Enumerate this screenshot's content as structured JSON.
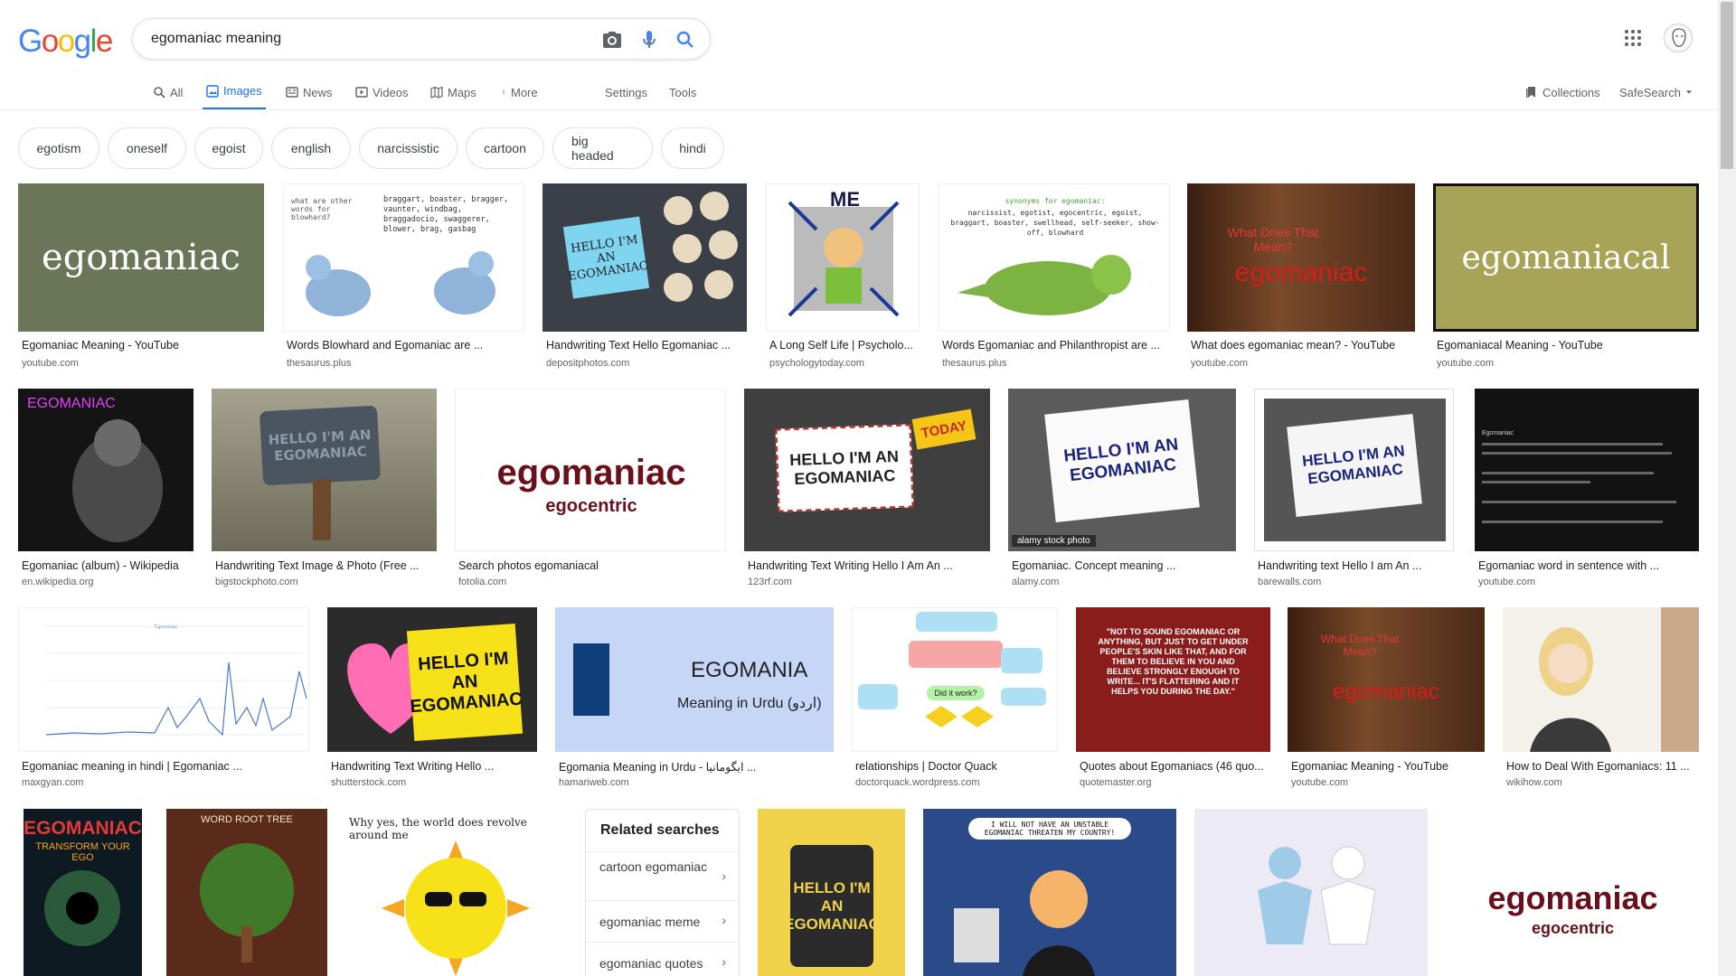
{
  "logo": {
    "letters": [
      "G",
      "o",
      "o",
      "g",
      "l",
      "e"
    ],
    "colors": [
      "#4285f4",
      "#ea4335",
      "#fbbc05",
      "#4285f4",
      "#34a853",
      "#ea4335"
    ]
  },
  "search": {
    "query": "egomaniac meaning",
    "icons": [
      "camera-icon",
      "mic-icon",
      "search-icon"
    ]
  },
  "tabs": [
    {
      "label": "All",
      "icon": "search-icon"
    },
    {
      "label": "Images",
      "icon": "image-icon",
      "active": true
    },
    {
      "label": "News",
      "icon": "news-icon"
    },
    {
      "label": "Videos",
      "icon": "video-icon"
    },
    {
      "label": "Maps",
      "icon": "map-icon"
    },
    {
      "label": "More",
      "icon": "more-vert-icon"
    },
    {
      "label": "Settings"
    },
    {
      "label": "Tools"
    },
    {
      "label": "Collections",
      "icon": "collections-icon"
    },
    {
      "label": "SafeSearch",
      "icon": "dropdown-icon"
    }
  ],
  "chips": [
    "egotism",
    "oneself",
    "egoist",
    "english",
    "narcissistic",
    "cartoon",
    "big headed",
    "hindi"
  ],
  "results": [
    {
      "title": "Egomaniac Meaning - YouTube",
      "domain": "youtube.com",
      "thumb_text": "egomaniac",
      "bg": "#6b7658"
    },
    {
      "title": "Words Blowhard and Egomaniac are ...",
      "domain": "thesaurus.plus",
      "thumb_text": "braggart, boaster, bragger, vaunter, windbag, braggadocio, swaggerer, blower, brag, gasbag",
      "sub_text": "what are other words for blowhard?",
      "bg": "#ffffff"
    },
    {
      "title": "Handwriting Text Hello Egomaniac ...",
      "domain": "depositphotos.com",
      "thumb_text": "HELLO I'M AN EGOMANIAC",
      "bg": "#3a3f48"
    },
    {
      "title": "A Long Self Life | Psycholo...",
      "domain": "psychologytoday.com",
      "thumb_text": "ME",
      "bg": "#ffffff"
    },
    {
      "title": "Words Egomaniac and Philanthropist are ...",
      "domain": "thesaurus.plus",
      "thumb_text": "synonyms for egomaniac:",
      "sub_text": "narcissist, egotist, egocentric, egoist, braggart, boaster, swellhead, self-seeker, show-off, blowhard",
      "bg": "#ffffff"
    },
    {
      "title": "What does egomaniac mean? - YouTube",
      "domain": "youtube.com",
      "thumb_text": "egomaniac",
      "sub_text": "What Does That Mean?",
      "bg": "#5a2f1c"
    },
    {
      "title": "Egomaniacal Meaning - YouTube",
      "domain": "youtube.com",
      "thumb_text": "egomaniacal",
      "bg": "#a7a457"
    },
    {
      "title": "Egomaniac (album) - Wikipedia",
      "domain": "en.wikipedia.org",
      "thumb_text": "EGOMANIAC",
      "bg": "#141414"
    },
    {
      "title": "Handwriting Text Image & Photo (Free ...",
      "domain": "bigstockphoto.com",
      "thumb_text": "HELLO I'M AN EGOMANIAC",
      "bg": "#8c8a77"
    },
    {
      "title": "Search photos egomaniacal",
      "domain": "fotolia.com",
      "thumb_text": "egomaniac",
      "sub_text": "egocentric",
      "bg": "#ffffff"
    },
    {
      "title": "Handwriting Text Writing Hello I Am An ...",
      "domain": "123rf.com",
      "thumb_text": "HELLO I'M AN EGOMANIAC",
      "sub_text": "TODAY",
      "bg": "#3f3f3f"
    },
    {
      "title": "Egomaniac. Concept meaning ...",
      "domain": "alamy.com",
      "thumb_text": "HELLO I'M AN EGOMANIAC",
      "sub_text": "alamy stock photo",
      "bg": "#5b5b5b"
    },
    {
      "title": "Handwriting text Hello I am An ...",
      "domain": "barewalls.com",
      "thumb_text": "HELLO I'M AN EGOMANIAC",
      "bg": "#555555"
    },
    {
      "title": "Egomaniac word in sentence with ...",
      "domain": "youtube.com",
      "thumb_text": "Egomaniac",
      "bg": "#121212"
    },
    {
      "title": "Egomaniac meaning in hindi | Egomaniac ...",
      "domain": "maxgyan.com",
      "thumb_text": "Egomaniac",
      "bg": "#ffffff"
    },
    {
      "title": "Handwriting Text Writing Hello ...",
      "domain": "shutterstock.com",
      "thumb_text": "HELLO I'M AN EGOMANIAC",
      "bg": "#2b2b2b"
    },
    {
      "title": "Egomania Meaning in Urdu - ایگومانیا ...",
      "domain": "hamariweb.com",
      "thumb_text": "EGOMANIA",
      "sub_text": "Meaning in Urdu (اردو)",
      "bg": "#c5d6f7"
    },
    {
      "title": "relationships | Doctor Quack",
      "domain": "doctorquack.wordpress.com",
      "thumb_text": "Did it work?",
      "bg": "#ffffff"
    },
    {
      "title": "Quotes about Egomaniacs (46 quo...",
      "domain": "quotemaster.org",
      "thumb_text": "\"NOT TO SOUND EGOMANIAC OR ANYTHING, BUT JUST TO GET UNDER PEOPLE'S SKIN LIKE THAT, AND FOR THEM TO BELIEVE IN YOU AND BELIEVE STRONGLY ENOUGH TO WRITE... IT'S FLATTERING AND IT HELPS YOU DURING THE DAY.\"",
      "bg": "#8b1c1c"
    },
    {
      "title": "Egomaniac Meaning - YouTube",
      "domain": "youtube.com",
      "thumb_text": "egomaniac",
      "sub_text": "What Does That Mean?",
      "bg": "#5a2f1c"
    },
    {
      "title": "How to Deal With Egomaniacs: 11 ...",
      "domain": "wikihow.com",
      "bg": "#d8dcc6"
    },
    {
      "thumb_text": "EGOMANIAC",
      "sub_text": "TRANSFORM YOUR EGO",
      "bg": "#0e1a22"
    },
    {
      "thumb_text": "WORD ROOT TREE",
      "bg": "#5a2a1a"
    },
    {
      "thumb_text": "Why yes, the world does revolve around me",
      "bg": "#ffffff"
    },
    {
      "thumb_text": "HELLO I'M AN EGOMANIAC",
      "bg": "#f0d34a"
    },
    {
      "thumb_text": "I WILL NOT HAVE AN UNSTABLE EGOMANIAC THREATEN MY COUNTRY!",
      "bg": "#2a4a8a"
    },
    {
      "bg": "#eceaf5"
    },
    {
      "thumb_text": "egomaniac",
      "sub_text": "egocentric",
      "bg": "#ffffff"
    }
  ],
  "related": {
    "title": "Related searches",
    "items": [
      "cartoon egomaniac",
      "egomaniac meme",
      "egomaniac quotes"
    ]
  }
}
